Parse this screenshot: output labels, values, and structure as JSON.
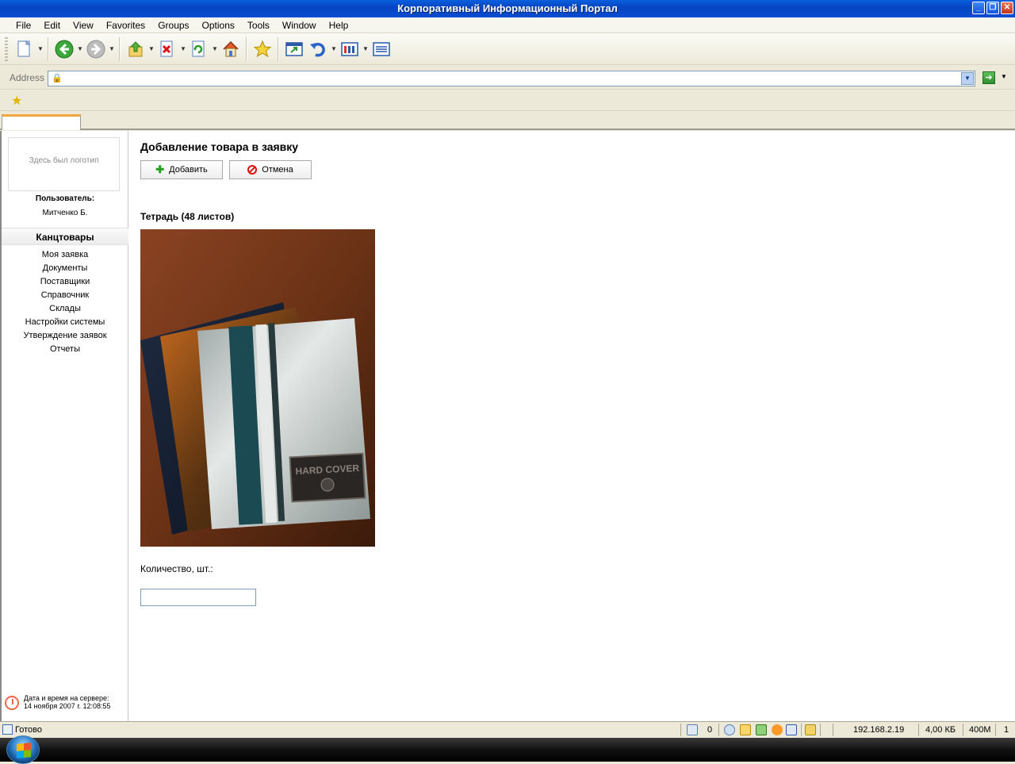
{
  "window": {
    "title": "Корпоративный Информационный Портал"
  },
  "menu": {
    "items": [
      "File",
      "Edit",
      "View",
      "Favorites",
      "Groups",
      "Options",
      "Tools",
      "Window",
      "Help"
    ]
  },
  "address": {
    "label": "Address",
    "value": ""
  },
  "sidebar": {
    "logo_text": "Здесь был логотип",
    "user_label": "Пользователь:",
    "user_name": "Митченко Б.",
    "section": "Канцтовары",
    "items": [
      "Моя заявка",
      "Документы",
      "Поставщики",
      "Справочник",
      "Склады",
      "Настройки системы",
      "Утверждение заявок",
      "Отчеты"
    ],
    "server_time_label": "Дата и время на сервере:",
    "server_time_value": "14 ноября 2007 г. 12:08:55"
  },
  "main": {
    "title": "Добавление товара в заявку",
    "add_label": "Добавить",
    "cancel_label": "Отмена",
    "product_name": "Тетрадь (48 листов)",
    "image_text": "HARD COVER",
    "qty_label": "Количество, шт.:",
    "qty_value": ""
  },
  "status": {
    "text": "Готово",
    "count": "0",
    "ip": "192.168.2.19",
    "size": "4,00 КБ",
    "mem": "400M",
    "num": "1"
  }
}
